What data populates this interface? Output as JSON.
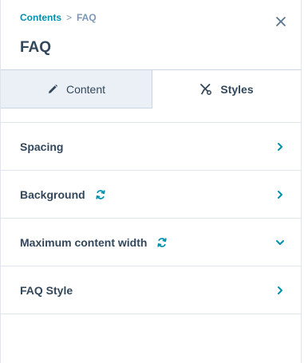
{
  "breadcrumb": {
    "parent": "Contents",
    "separator": ">",
    "current": "FAQ"
  },
  "title": "FAQ",
  "tabs": [
    {
      "label": "Content",
      "icon": "pencil-icon",
      "active": false
    },
    {
      "label": "Styles",
      "icon": "scissors-icon",
      "active": true
    }
  ],
  "sections": [
    {
      "label": "Spacing",
      "sync": false,
      "chevron": "right"
    },
    {
      "label": "Background",
      "sync": true,
      "chevron": "right"
    },
    {
      "label": "Maximum content width",
      "sync": true,
      "chevron": "down"
    },
    {
      "label": "FAQ Style",
      "sync": false,
      "chevron": "right"
    }
  ],
  "colors": {
    "accent": "#0091ae",
    "text": "#33475b",
    "muted": "#7c98b6",
    "tab_inactive_bg": "#eaf0f6",
    "border": "#dfe3eb"
  }
}
